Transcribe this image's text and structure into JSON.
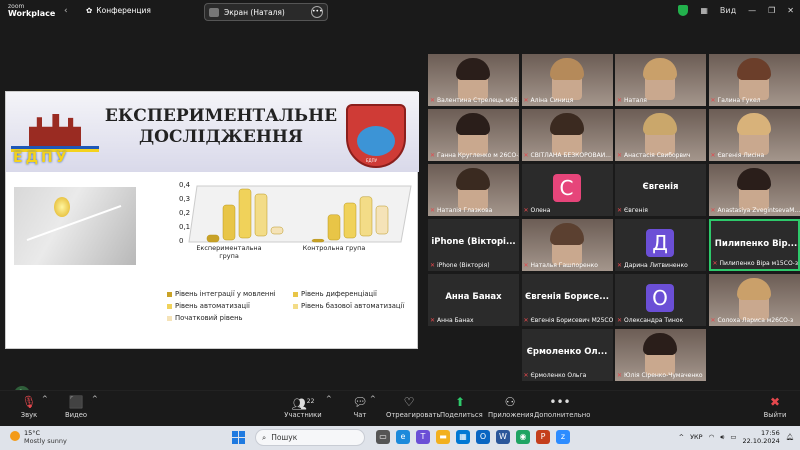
{
  "topbar": {
    "app_line1": "zoom",
    "app_line2": "Workplace",
    "meeting_label": "Конференция",
    "share_label": "Экран (Наталя)",
    "view_label": "Вид"
  },
  "slide": {
    "title": "ЕКСПЕРИМЕНТАЛЬНЕ ДОСЛІДЖЕННЯ",
    "logo_left_text": "ЕДПУ",
    "logo_right_text": "ЕДПУ"
  },
  "chart_data": {
    "type": "bar",
    "categories": [
      "Експериментальна група",
      "Контрольна група"
    ],
    "series": [
      {
        "name": "Рівень інтеграції у мовленні",
        "values": [
          0.05,
          0.02
        ]
      },
      {
        "name": "Рівень диференціації",
        "values": [
          0.25,
          0.18
        ]
      },
      {
        "name": "Рівень автоматизації",
        "values": [
          0.35,
          0.25
        ]
      },
      {
        "name": "Рівень базової автоматизації",
        "values": [
          0.3,
          0.28
        ]
      },
      {
        "name": "Початковий рівень",
        "values": [
          0.05,
          0.2
        ]
      }
    ],
    "yticks": [
      "0,4",
      "0,3",
      "0,2",
      "0,1",
      "0"
    ],
    "ylim": [
      0,
      0.4
    ],
    "colors": [
      "#c9a227",
      "#e8c547",
      "#f0d25a",
      "#f3dc87",
      "#f5e3b8"
    ]
  },
  "participants": [
    {
      "name": "Валентина Стрелець м26...",
      "kind": "video",
      "hair": "#2a1e1a"
    },
    {
      "name": "Аліна Синиця",
      "kind": "video",
      "hair": "#b58a5a"
    },
    {
      "name": "Наталя",
      "kind": "video",
      "hair": "#c9a06a"
    },
    {
      "name": "Галина Гукел",
      "kind": "video",
      "hair": "#6b3e2a"
    },
    {
      "name": "Ганна Кругленко м 26СО-з",
      "kind": "video",
      "hair": "#2a1e1a"
    },
    {
      "name": "СВІТЛАНА БЕЗКОРОВАЙ...",
      "kind": "video",
      "hair": "#3b2a20"
    },
    {
      "name": "Анастасія Свиборвич",
      "kind": "video",
      "hair": "#caa76b"
    },
    {
      "name": "Євгенія Лисіна",
      "kind": "video",
      "hair": "#d8b27a"
    },
    {
      "name": "Наталія Глазкова",
      "kind": "video",
      "hair": "#3a2a20"
    },
    {
      "name": "Олена",
      "kind": "avatar",
      "letter": "С",
      "color": "#e6457a"
    },
    {
      "name": "Євгенія",
      "kind": "bigname",
      "big": "Євгенія"
    },
    {
      "name": "Anastasiya ZvegintsevaM...",
      "kind": "video",
      "hair": "#2a1e1a"
    },
    {
      "name": "iPhone (Вікторія)",
      "kind": "bigname",
      "big": "iPhone (Вікторі..."
    },
    {
      "name": "Наталья Гашпоренко",
      "kind": "video",
      "hair": "#5b4030"
    },
    {
      "name": "Дарина Литвиненко",
      "kind": "avatar",
      "letter": "Д",
      "color": "#6b4fd6"
    },
    {
      "name": "Пилипенко Віра м15СО-з",
      "kind": "bigname",
      "big": "Пилипенко Вір...",
      "active": true
    },
    {
      "name": "Анна Банах",
      "kind": "bigname",
      "big": "Анна Банах"
    },
    {
      "name": "Євгенія Борисевич М25СО-з",
      "kind": "bigname",
      "big": "Євгенія Борисе..."
    },
    {
      "name": "Олександра Тинок",
      "kind": "avatar",
      "letter": "О",
      "color": "#6b4fd6"
    },
    {
      "name": "Солоха Лариса м26СО-з",
      "kind": "video",
      "hair": "#caa06a"
    },
    {
      "name": "Єрмоленко Ольга",
      "kind": "bigname",
      "big": "Єрмоленко Ол..."
    },
    {
      "name": "Юлія Сіренко-Чумаченко",
      "kind": "video",
      "hair": "#2a1e1a"
    }
  ],
  "toolbar": {
    "audio": "Звук",
    "video": "Видео",
    "participants": "Участники",
    "participants_count": "22",
    "chat": "Чат",
    "react": "Отреагировать",
    "share": "Поделиться",
    "apps": "Приложения",
    "more": "Дополнительно",
    "leave": "Выйти"
  },
  "taskbar": {
    "temp": "15°C",
    "weather": "Mostly sunny",
    "search": "Пошук",
    "lang": "УКР",
    "time": "17:56",
    "date": "22.10.2024"
  }
}
